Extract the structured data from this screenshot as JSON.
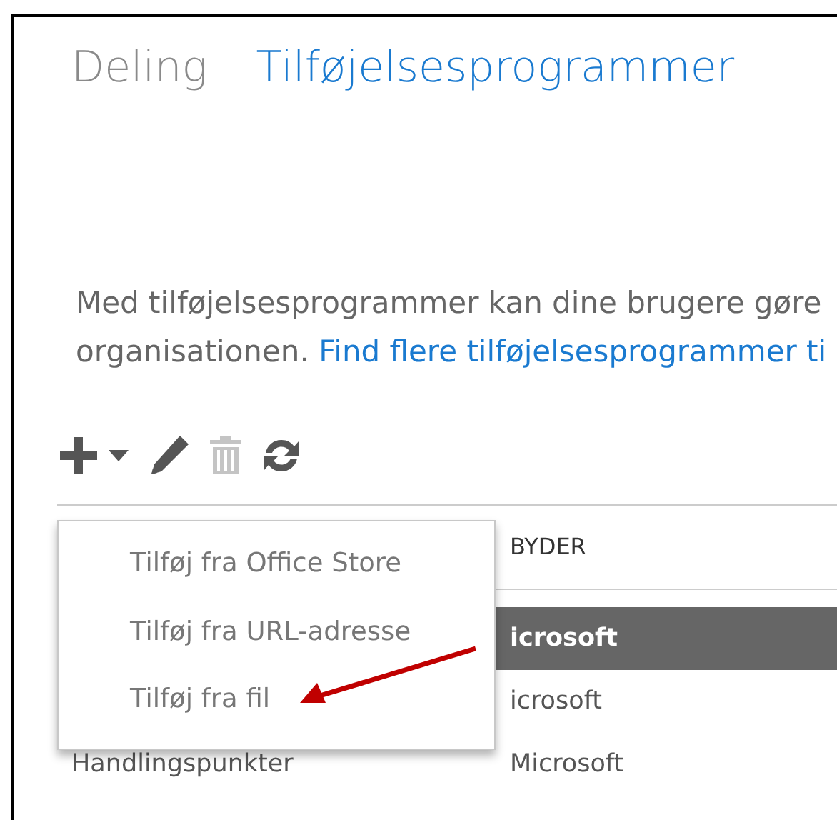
{
  "tabs": [
    {
      "label": "Deling",
      "selected": false
    },
    {
      "label": "Tilføjelsesprogrammer",
      "selected": true
    }
  ],
  "description": {
    "line_1": "Med tilføjelsesprogrammer kan dine brugere gøre",
    "line_2": "organisationen.",
    "link": "Find flere tilføjelsesprogrammer ti"
  },
  "toolbar": [
    {
      "kind": "add",
      "disabled": false
    },
    {
      "kind": "caret",
      "disabled": false
    },
    {
      "kind": "edit",
      "disabled": false
    },
    {
      "kind": "delete",
      "disabled": true
    },
    {
      "kind": "refresh",
      "disabled": false
    }
  ],
  "table": {
    "column_2_header": "BYDER",
    "rows": [
      {
        "column_2": "icrosoft",
        "selected": true
      },
      {
        "column_2": "icrosoft",
        "selected": false
      },
      {
        "column_1": "Handlingspunkter",
        "column_2": "Microsoft",
        "selected": false
      }
    ]
  },
  "menu": {
    "items": [
      "Tilføj fra Office Store",
      "Tilføj fra URL-adresse",
      "Tilføj fra fil"
    ]
  }
}
